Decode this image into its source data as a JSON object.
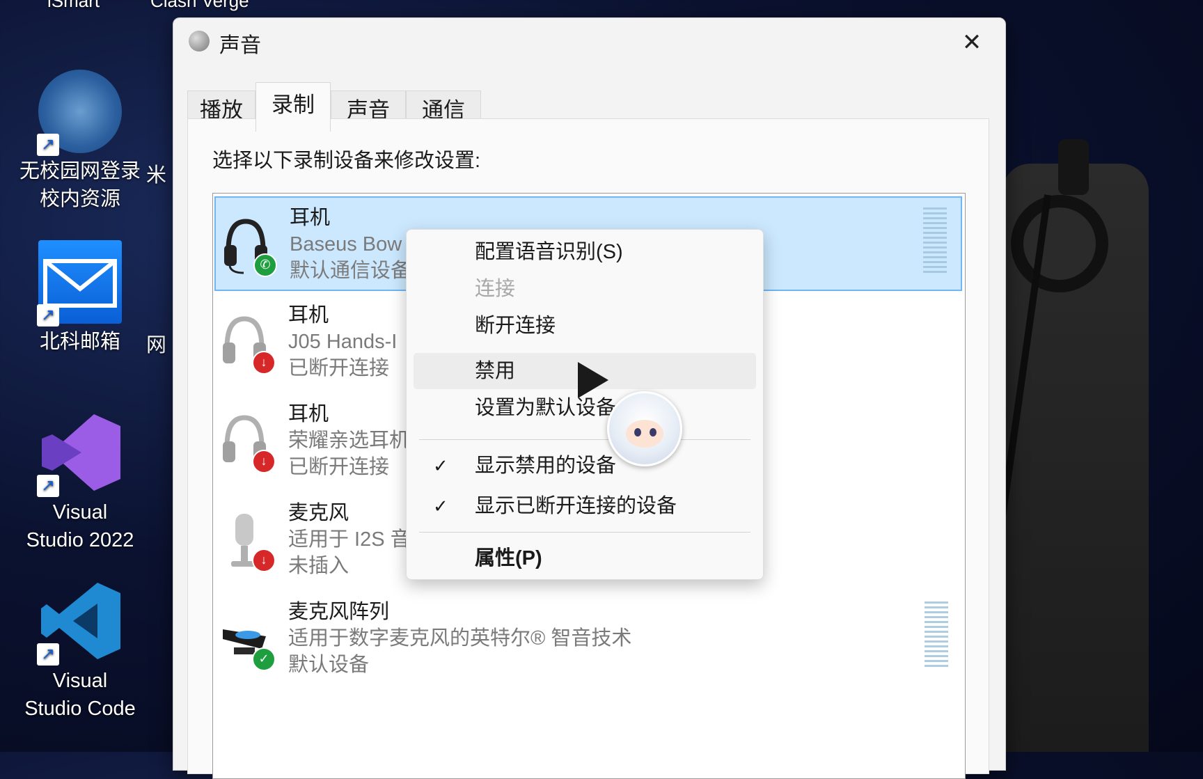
{
  "desktop": {
    "top_labels": [
      "iSmart",
      "Clash Verge"
    ],
    "icons": [
      {
        "label": "无校园网登录\n校内资源"
      },
      {
        "label": "北科邮箱"
      },
      {
        "label": "Visual\nStudio 2022"
      },
      {
        "label": "Visual\nStudio Code"
      }
    ],
    "peek_labels": [
      "米",
      "网"
    ]
  },
  "window": {
    "title": "声音",
    "close_glyph": "✕",
    "tabs": [
      {
        "label": "播放",
        "active": false
      },
      {
        "label": "录制",
        "active": true
      },
      {
        "label": "声音",
        "active": false
      },
      {
        "label": "通信",
        "active": false
      }
    ],
    "instruction": "选择以下录制设备来修改设置:",
    "devices": [
      {
        "name": "耳机",
        "detail": "Baseus Bow",
        "status": "默认通信设备",
        "icon": "headset-icon",
        "badge": "phone-badge",
        "selected": true,
        "level": true
      },
      {
        "name": "耳机",
        "detail": "J05 Hands-I",
        "status": "已断开连接",
        "icon": "headset-icon",
        "badge": "disconnected-badge",
        "selected": false,
        "level": false
      },
      {
        "name": "耳机",
        "detail": "荣耀亲选耳机",
        "status": "已断开连接",
        "icon": "headset-icon",
        "badge": "disconnected-badge",
        "selected": false,
        "level": false
      },
      {
        "name": "麦克风",
        "detail": "适用于 I2S 音",
        "status": "未插入",
        "icon": "microphone-icon",
        "badge": "disconnected-badge",
        "selected": false,
        "level": false
      },
      {
        "name": "麦克风阵列",
        "detail": "适用于数字麦克风的英特尔® 智音技术",
        "status": "默认设备",
        "icon": "mic-array-icon",
        "badge": "check-badge",
        "selected": false,
        "level": true
      }
    ]
  },
  "context_menu": {
    "items": [
      {
        "label": "配置语音识别(S)",
        "disabled": false,
        "checked": false
      },
      {
        "label": "连接",
        "disabled": true,
        "checked": false
      },
      {
        "label": "断开连接",
        "disabled": false,
        "checked": false
      },
      {
        "label": "禁用",
        "disabled": false,
        "checked": false,
        "hover": true
      },
      {
        "label": "设置为默认设备",
        "disabled": false,
        "checked": false
      },
      {
        "label": "显示禁用的设备",
        "disabled": false,
        "checked": true
      },
      {
        "label": "显示已断开连接的设备",
        "disabled": false,
        "checked": true
      },
      {
        "label": "属性(P)",
        "disabled": false,
        "checked": false,
        "bold": true
      }
    ],
    "check_glyph": "✓"
  },
  "colors": {
    "selection": "#cce8ff",
    "selection_border": "#6eb6f5",
    "ok_badge": "#1e9e3e",
    "down_badge": "#d62828"
  }
}
